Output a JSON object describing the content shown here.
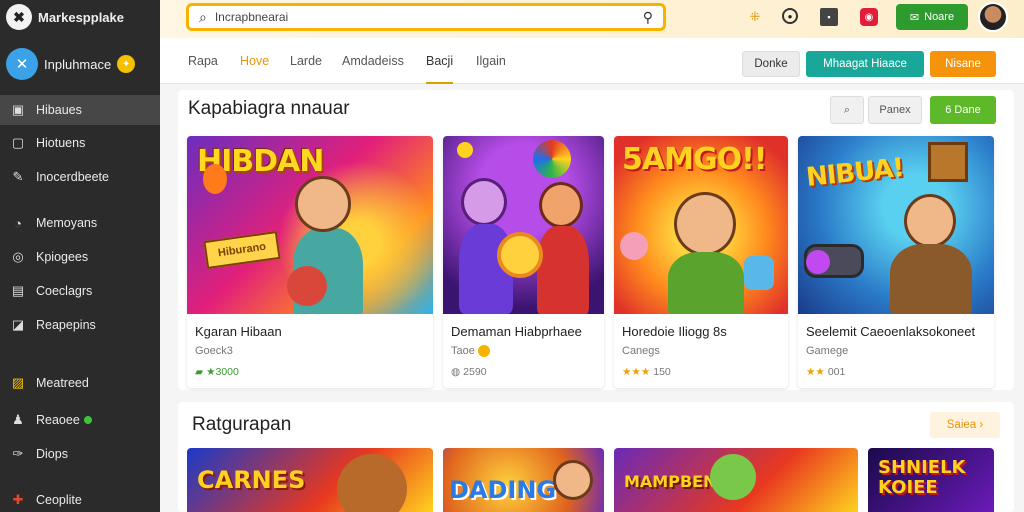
{
  "brand": {
    "name": "Markespplake",
    "logo_icon": "✖"
  },
  "account": {
    "name": "Inpluhmace",
    "badge": "✦"
  },
  "sidebar": {
    "items": [
      {
        "label": "Hibaues",
        "icon": "▣"
      },
      {
        "label": "Hiotuens",
        "icon": "▢"
      },
      {
        "label": "Inocerdbeete",
        "icon": "✎"
      },
      {
        "label": "Memoyans",
        "icon": "◔"
      },
      {
        "label": "Kpiogees",
        "icon": "◎"
      },
      {
        "label": "Coeclagrs",
        "icon": "▤"
      },
      {
        "label": "Reapepins",
        "icon": "◪"
      },
      {
        "label": "Meatreed",
        "icon": "▨"
      },
      {
        "label": "Reaoee",
        "icon": "♟"
      },
      {
        "label": "Diops",
        "icon": "✑"
      },
      {
        "label": "Ceoplite",
        "icon": "✚"
      }
    ]
  },
  "search": {
    "value": "Incrapbnearai"
  },
  "topbar": {
    "button_label": "Noare"
  },
  "tabs": [
    {
      "label": "Rapa"
    },
    {
      "label": "Hove"
    },
    {
      "label": "Larde"
    },
    {
      "label": "Amdadeiss"
    },
    {
      "label": "Bacji"
    },
    {
      "label": "Ilgain"
    }
  ],
  "header_buttons": {
    "b1": "Donke",
    "b2": "Mhaagat Hiaace",
    "b3": "Nisane"
  },
  "section1": {
    "title": "Kapabiagra nnauar",
    "sort_label": "Panex",
    "action_label": "6 Dane"
  },
  "cards": [
    {
      "title": "Kgaran Hibaan",
      "sub": "Goeck3",
      "meta": "★3000",
      "art": "HIBDAN",
      "sign": "Hiburano"
    },
    {
      "title": "Demaman Hiabprhaee",
      "sub": "Taoe",
      "meta": "2590"
    },
    {
      "title": "Horedoie Iliogg  8s",
      "sub": "Canegs",
      "meta": "150",
      "art": "5AMGO!!"
    },
    {
      "title": "Seelemit Caeoenlaksokoneet",
      "sub": "Gamege",
      "meta": "001",
      "art": "NIBUA!"
    }
  ],
  "section2": {
    "title": "Ratgurapan",
    "more_label": "Saiea"
  },
  "minis": [
    {
      "art": "CARNES"
    },
    {
      "art": "DADING"
    },
    {
      "art": "MAMPBEN"
    },
    {
      "art": "SHNIELK KOIEE"
    }
  ]
}
